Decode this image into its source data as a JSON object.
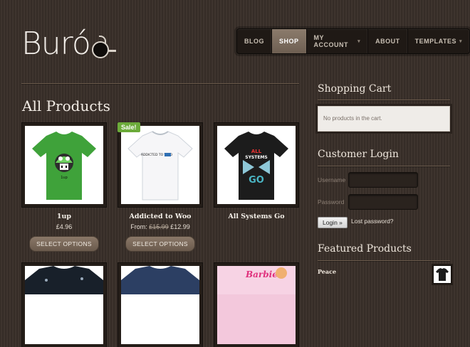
{
  "site": {
    "logo_text": "Buró"
  },
  "nav": {
    "items": [
      {
        "label": "BLOG"
      },
      {
        "label": "SHOP"
      },
      {
        "label": "MY ACCOUNT"
      },
      {
        "label": "ABOUT"
      },
      {
        "label": "TEMPLATES"
      }
    ],
    "active": "SHOP",
    "caret": "▾"
  },
  "main": {
    "title": "All Products",
    "sale_badge": "Sale!",
    "products": [
      {
        "name": "1up",
        "price": "£4.96",
        "button": "SELECT OPTIONS"
      },
      {
        "name": "Addicted to Woo",
        "price_prefix": "From:",
        "old_price": "£15.99",
        "price": "£12.99",
        "button": "SELECT OPTIONS"
      },
      {
        "name": "All Systems Go"
      }
    ],
    "shirt_prints": {
      "addicted": "ADDICTED TO WOO",
      "all_line1": "ALL",
      "all_line2": "SYSTEMS",
      "all_line3": "GO",
      "barbie": "Barbie"
    }
  },
  "sidebar": {
    "cart": {
      "heading": "Shopping Cart",
      "empty_text": "No products in the cart."
    },
    "login": {
      "heading": "Customer Login",
      "username_label": "Username",
      "password_label": "Password",
      "button": "Login »",
      "lost_password": "Lost password?"
    },
    "featured": {
      "heading": "Featured Products",
      "item_name": "Peace"
    }
  },
  "colors": {
    "background": "#3a302a",
    "accent_nav_active": "#7d6e60",
    "sale_green": "#6cab3a",
    "shirt_green": "#3fa23a"
  }
}
